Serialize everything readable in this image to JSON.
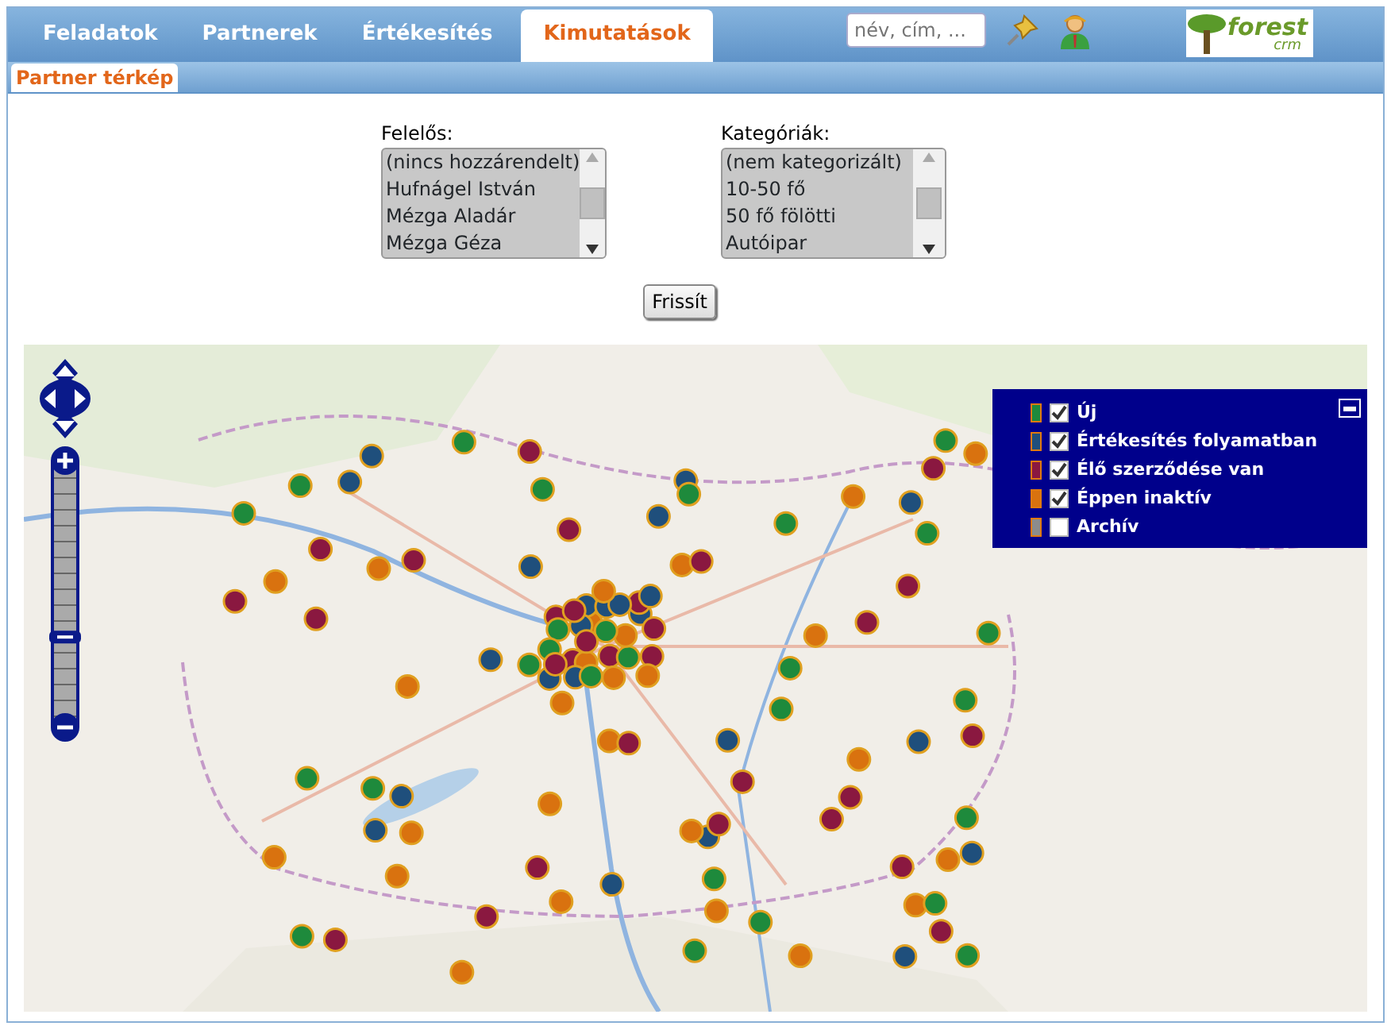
{
  "nav": {
    "tabs": [
      {
        "label": "Feladatok",
        "selected": false
      },
      {
        "label": "Partnerek",
        "selected": false
      },
      {
        "label": "Értékesítés",
        "selected": false
      },
      {
        "label": "Kimutatások",
        "selected": true
      }
    ],
    "search": {
      "placeholder": "név, cím, ..."
    },
    "logo": {
      "text": "forest",
      "sub": "crm"
    }
  },
  "subtabs": [
    {
      "label": "Partner térkép",
      "selected": true
    }
  ],
  "filters": [
    {
      "label": "Felelős:",
      "options": [
        "(nincs hozzárendelt)",
        "Hufnágel István",
        "Mézga Aladár",
        "Mézga Géza"
      ]
    },
    {
      "label": "Kategóriák:",
      "options": [
        "(nem kategorizált)",
        "10-50 fő",
        "50 fő fölötti",
        "Autóipar"
      ]
    }
  ],
  "refresh_button": "Frissít",
  "map": {
    "kind": "picture",
    "zoom": {
      "level": 0.35
    },
    "legend": [
      {
        "label": "Új",
        "color": "#1e8a3c",
        "checked": true
      },
      {
        "label": "Értékesítés folyamatban",
        "color": "#1f4f7c",
        "checked": true
      },
      {
        "label": "Élő szerződése van",
        "color": "#8a1840",
        "checked": true
      },
      {
        "label": "Éppen inaktív",
        "color": "#d9720f",
        "checked": true
      },
      {
        "label": "Archív",
        "color": "#8c8c8c",
        "checked": false
      }
    ]
  }
}
